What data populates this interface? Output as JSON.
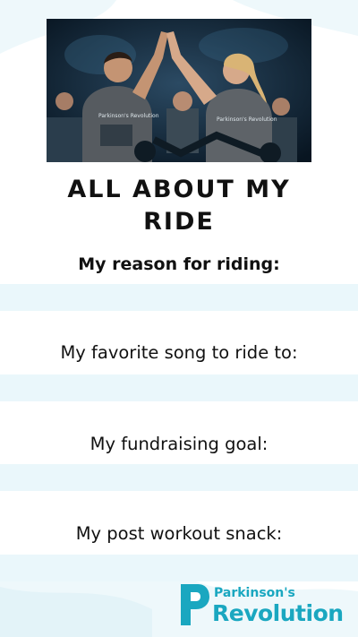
{
  "colors": {
    "accent": "#1aa7c0",
    "band": "#eaf7fb",
    "wave": "#eef8fb",
    "text": "#111111"
  },
  "photo": {
    "subject": "two people on spin bikes giving a high five, wearing Parkinson's Revolution tank tops",
    "shirt_text_left": "Parkinson's Revolution",
    "shirt_text_right": "Parkinson's Revolution"
  },
  "title": {
    "line1": "ALL ABOUT MY",
    "line2": "RIDE"
  },
  "prompts": [
    {
      "label": "My reason for riding:"
    },
    {
      "label": "My favorite song to ride to:"
    },
    {
      "label": "My fundraising goal:"
    },
    {
      "label": "My post workout snack:"
    }
  ],
  "logo": {
    "icon": "parkinsons-revolution-logo-mark",
    "top_text": "Parkinson's",
    "bottom_text": "Revolution"
  }
}
